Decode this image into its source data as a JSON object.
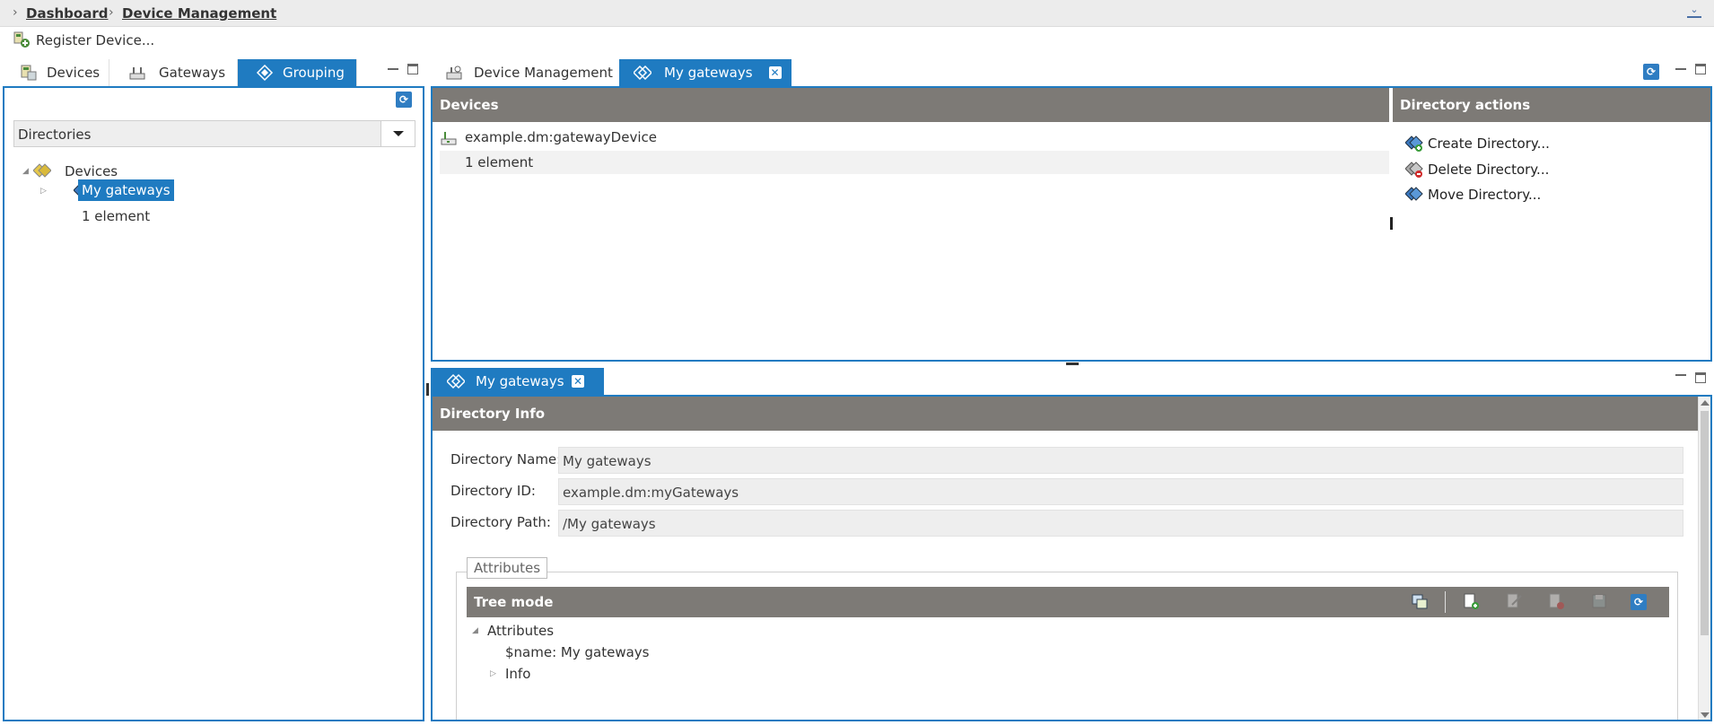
{
  "breadcrumb": {
    "home": "Dashboard",
    "current": "Device Management"
  },
  "toolbar": {
    "register_label": "Register Device..."
  },
  "left_tabs": [
    {
      "label": "Devices",
      "icon": "devices-icon"
    },
    {
      "label": "Gateways",
      "icon": "gateway-icon"
    },
    {
      "label": "Grouping",
      "icon": "grouping-icon",
      "active": true
    }
  ],
  "directories_select": {
    "value": "Directories"
  },
  "tree": {
    "root": "Devices",
    "selected": "My gateways",
    "count": "1 element"
  },
  "main_tabs": [
    {
      "label": "Device Management",
      "icon": "device-management-icon"
    },
    {
      "label": "My gateways",
      "icon": "grouping-icon",
      "active": true
    }
  ],
  "devices_panel": {
    "title": "Devices",
    "rows": [
      {
        "name": "example.dm:gatewayDevice"
      }
    ],
    "count": "1 element"
  },
  "actions_panel": {
    "title": "Directory actions",
    "items": [
      {
        "label": "Create Directory...",
        "icon": "create-directory-icon"
      },
      {
        "label": "Delete Directory...",
        "icon": "delete-directory-icon"
      },
      {
        "label": "Move Directory...",
        "icon": "move-directory-icon"
      }
    ]
  },
  "detail_tab": {
    "label": "My gateways"
  },
  "directory_info": {
    "title": "Directory Info",
    "name_label": "Directory Name:",
    "name_value": "My gateways",
    "id_label": "Directory ID:",
    "id_value": "example.dm:myGateways",
    "path_label": "Directory Path:",
    "path_value": "/My gateways"
  },
  "attributes": {
    "legend": "Attributes",
    "mode_title": "Tree mode",
    "root": "Attributes",
    "name_entry": "$name: My gateways",
    "info": "Info"
  },
  "colors": {
    "accent": "#1f7bc1",
    "header_gray": "#7d7a76",
    "field_bg": "#eeeeee"
  }
}
